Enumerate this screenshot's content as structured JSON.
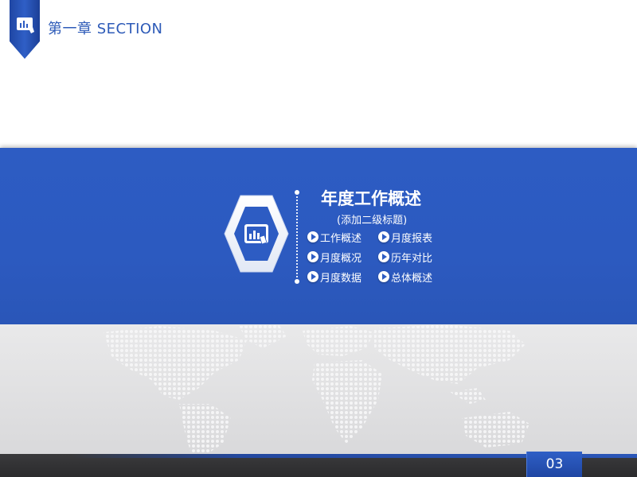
{
  "header": {
    "section_title": "第一章  SECTION"
  },
  "content": {
    "title": "年度工作概述",
    "subtitle": "(添加二级标题)",
    "items": [
      "工作概述",
      "月度报表",
      "月度概况",
      "历年对比",
      "月度数据",
      "总体概述"
    ]
  },
  "footer": {
    "page_number": "03"
  },
  "colors": {
    "brand_blue": "#2d5cc3",
    "dark_bar": "#2b2b2d",
    "map_grey": "#dedede"
  },
  "icons": {
    "ribbon": "chart-tablet-icon",
    "hexagon": "chart-tablet-icon",
    "bullets": "play-icon"
  }
}
